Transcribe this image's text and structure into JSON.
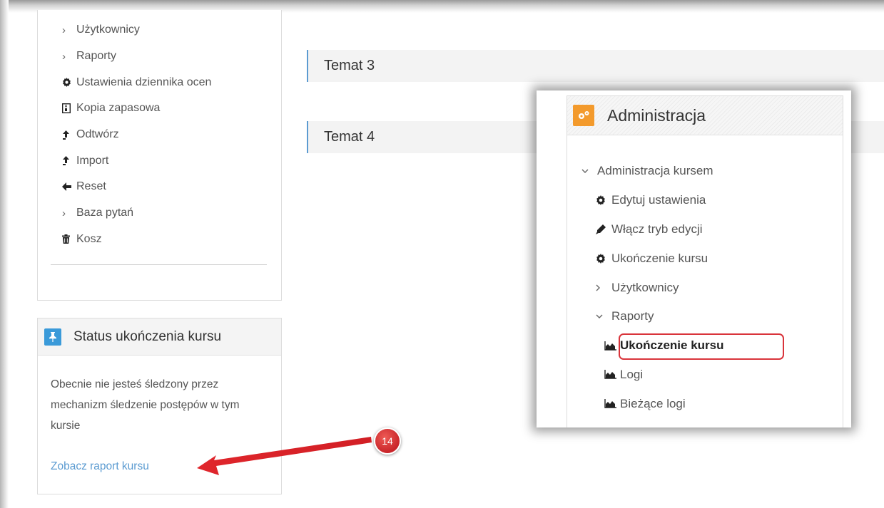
{
  "nav": {
    "items": [
      {
        "icon": "chevron-right-icon",
        "label": "Użytkownicy"
      },
      {
        "icon": "chevron-right-icon",
        "label": "Raporty"
      },
      {
        "icon": "cog-icon",
        "label": "Ustawienia dziennika ocen"
      },
      {
        "icon": "file-archive-icon",
        "label": "Kopia zapasowa"
      },
      {
        "icon": "upload-icon",
        "label": "Odtwórz"
      },
      {
        "icon": "upload-icon",
        "label": "Import"
      },
      {
        "icon": "arrow-left-icon",
        "label": "Reset"
      },
      {
        "icon": "chevron-right-icon",
        "label": "Baza pytań"
      },
      {
        "icon": "trash-icon",
        "label": "Kosz"
      }
    ]
  },
  "status_block": {
    "title": "Status ukończenia kursu",
    "text": "Obecnie nie jesteś śledzony przez mechanizm śledzenie postępów w tym kursie",
    "link": "Zobacz raport kursu",
    "icon_color": "#3a9ad9"
  },
  "topics": [
    "Temat 3",
    "Temat 4"
  ],
  "admin": {
    "title": "Administracja",
    "icon_color": "#f39a2c",
    "items": [
      {
        "level": 0,
        "icon": "chevron-down-icon",
        "label": "Administracja kursem"
      },
      {
        "level": 1,
        "icon": "cog-icon",
        "label": "Edytuj ustawienia"
      },
      {
        "level": 1,
        "icon": "pencil-icon",
        "label": "Włącz tryb edycji"
      },
      {
        "level": 1,
        "icon": "cog-icon",
        "label": "Ukończenie kursu"
      },
      {
        "level": 1,
        "icon": "chevron-right-icon",
        "label": "Użytkownicy"
      },
      {
        "level": 1,
        "icon": "chevron-down-icon",
        "label": "Raporty"
      },
      {
        "level": 2,
        "icon": "area-chart-icon",
        "label": "Ukończenie kursu",
        "active": true
      },
      {
        "level": 2,
        "icon": "area-chart-icon",
        "label": "Logi"
      },
      {
        "level": 2,
        "icon": "area-chart-icon",
        "label": "Bieżące logi"
      }
    ]
  },
  "annotation": {
    "number": "14",
    "color": "#d9343b"
  }
}
